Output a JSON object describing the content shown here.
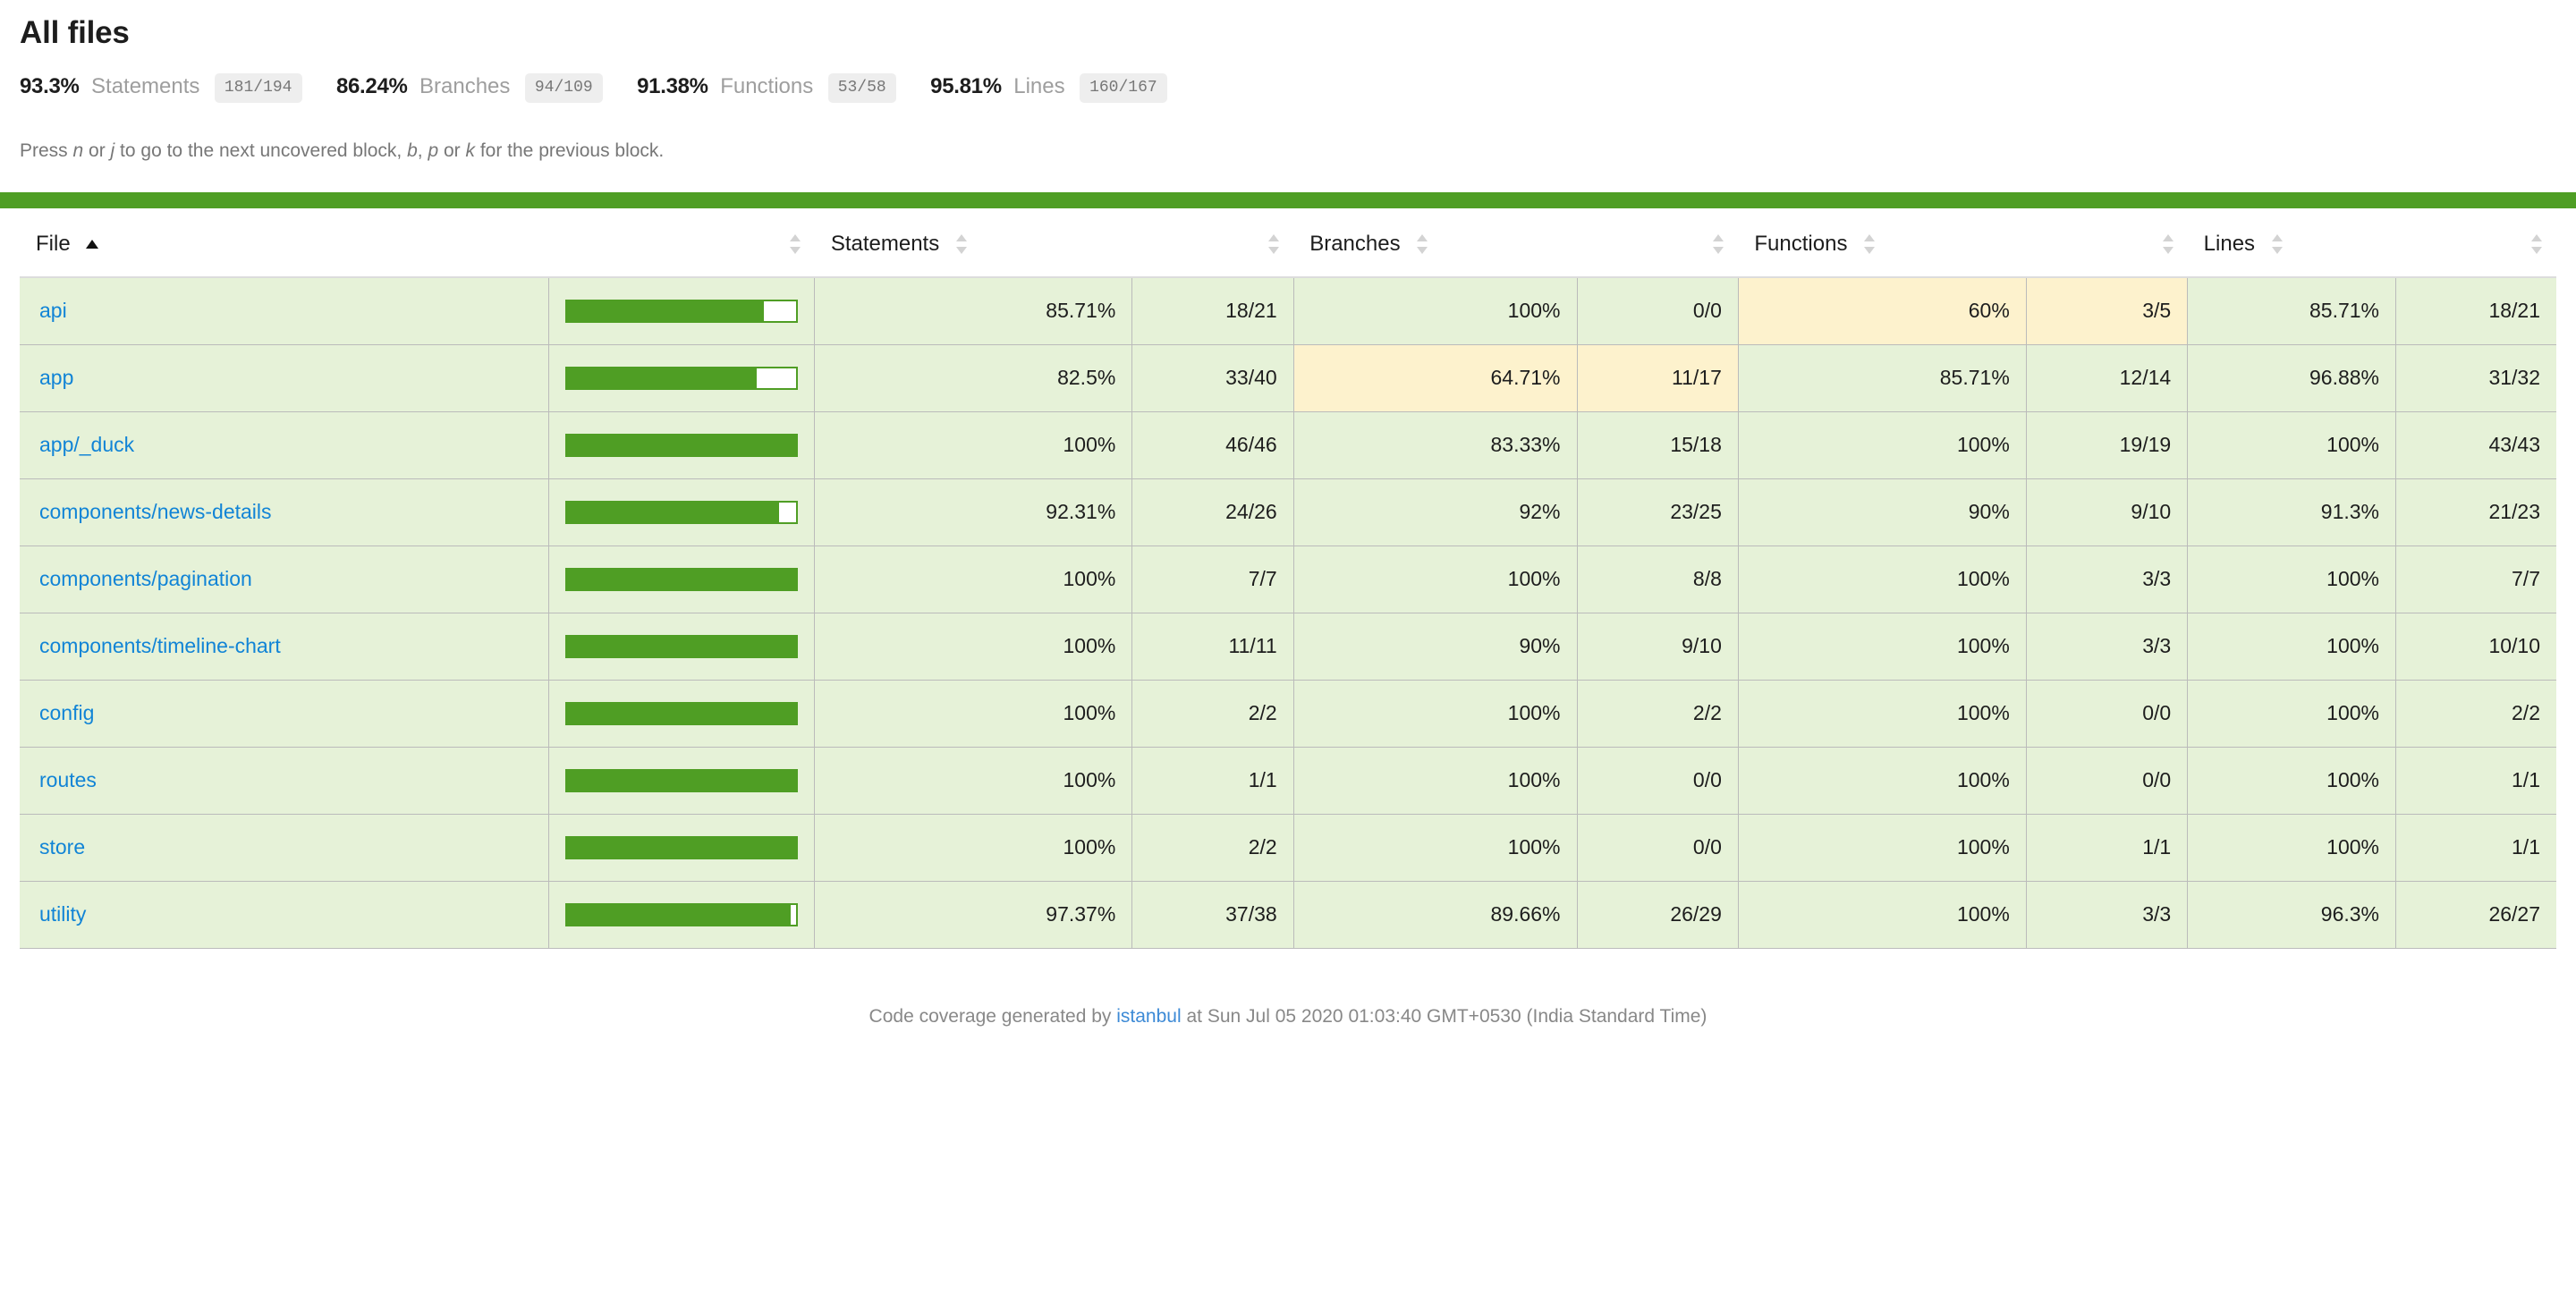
{
  "header": {
    "title": "All files",
    "summary": [
      {
        "pct": "93.3%",
        "label": "Statements",
        "fraction": "181/194"
      },
      {
        "pct": "86.24%",
        "label": "Branches",
        "fraction": "94/109"
      },
      {
        "pct": "91.38%",
        "label": "Functions",
        "fraction": "53/58"
      },
      {
        "pct": "95.81%",
        "label": "Lines",
        "fraction": "160/167"
      }
    ],
    "help_parts": {
      "p1": "Press ",
      "k1": "n",
      "p2": " or ",
      "k2": "j",
      "p3": " to go to the next uncovered block, ",
      "k3": "b",
      "p4": ", ",
      "k4": "p",
      "p5": " or ",
      "k5": "k",
      "p6": " for the previous block."
    },
    "status_color": "#4f9e24"
  },
  "table": {
    "columns": [
      {
        "key": "file",
        "label": "File",
        "sort": "asc"
      },
      {
        "key": "pic",
        "label": "",
        "sort": "none"
      },
      {
        "key": "statements",
        "label": "Statements",
        "sort": "none"
      },
      {
        "key": "statements_raw",
        "label": "",
        "sort": "none"
      },
      {
        "key": "branches",
        "label": "Branches",
        "sort": "none"
      },
      {
        "key": "branches_raw",
        "label": "",
        "sort": "none"
      },
      {
        "key": "functions",
        "label": "Functions",
        "sort": "none"
      },
      {
        "key": "functions_raw",
        "label": "",
        "sort": "none"
      },
      {
        "key": "lines",
        "label": "Lines",
        "sort": "none"
      },
      {
        "key": "lines_raw",
        "label": "",
        "sort": "none"
      }
    ],
    "rows": [
      {
        "file": "api",
        "bar_pct": 85.71,
        "bar_class": "high",
        "statements": {
          "pct": "85.71%",
          "raw": "18/21",
          "state": "high"
        },
        "branches": {
          "pct": "100%",
          "raw": "0/0",
          "state": "high"
        },
        "functions": {
          "pct": "60%",
          "raw": "3/5",
          "state": "medium"
        },
        "lines": {
          "pct": "85.71%",
          "raw": "18/21",
          "state": "high"
        }
      },
      {
        "file": "app",
        "bar_pct": 82.5,
        "bar_class": "high",
        "statements": {
          "pct": "82.5%",
          "raw": "33/40",
          "state": "high"
        },
        "branches": {
          "pct": "64.71%",
          "raw": "11/17",
          "state": "medium"
        },
        "functions": {
          "pct": "85.71%",
          "raw": "12/14",
          "state": "high"
        },
        "lines": {
          "pct": "96.88%",
          "raw": "31/32",
          "state": "high"
        }
      },
      {
        "file": "app/_duck",
        "bar_pct": 100,
        "bar_class": "high",
        "statements": {
          "pct": "100%",
          "raw": "46/46",
          "state": "high"
        },
        "branches": {
          "pct": "83.33%",
          "raw": "15/18",
          "state": "high"
        },
        "functions": {
          "pct": "100%",
          "raw": "19/19",
          "state": "high"
        },
        "lines": {
          "pct": "100%",
          "raw": "43/43",
          "state": "high"
        }
      },
      {
        "file": "components/news-details",
        "bar_pct": 92.31,
        "bar_class": "high",
        "statements": {
          "pct": "92.31%",
          "raw": "24/26",
          "state": "high"
        },
        "branches": {
          "pct": "92%",
          "raw": "23/25",
          "state": "high"
        },
        "functions": {
          "pct": "90%",
          "raw": "9/10",
          "state": "high"
        },
        "lines": {
          "pct": "91.3%",
          "raw": "21/23",
          "state": "high"
        }
      },
      {
        "file": "components/pagination",
        "bar_pct": 100,
        "bar_class": "high",
        "statements": {
          "pct": "100%",
          "raw": "7/7",
          "state": "high"
        },
        "branches": {
          "pct": "100%",
          "raw": "8/8",
          "state": "high"
        },
        "functions": {
          "pct": "100%",
          "raw": "3/3",
          "state": "high"
        },
        "lines": {
          "pct": "100%",
          "raw": "7/7",
          "state": "high"
        }
      },
      {
        "file": "components/timeline-chart",
        "bar_pct": 100,
        "bar_class": "high",
        "statements": {
          "pct": "100%",
          "raw": "11/11",
          "state": "high"
        },
        "branches": {
          "pct": "90%",
          "raw": "9/10",
          "state": "high"
        },
        "functions": {
          "pct": "100%",
          "raw": "3/3",
          "state": "high"
        },
        "lines": {
          "pct": "100%",
          "raw": "10/10",
          "state": "high"
        }
      },
      {
        "file": "config",
        "bar_pct": 100,
        "bar_class": "high",
        "statements": {
          "pct": "100%",
          "raw": "2/2",
          "state": "high"
        },
        "branches": {
          "pct": "100%",
          "raw": "2/2",
          "state": "high"
        },
        "functions": {
          "pct": "100%",
          "raw": "0/0",
          "state": "high"
        },
        "lines": {
          "pct": "100%",
          "raw": "2/2",
          "state": "high"
        }
      },
      {
        "file": "routes",
        "bar_pct": 100,
        "bar_class": "high",
        "statements": {
          "pct": "100%",
          "raw": "1/1",
          "state": "high"
        },
        "branches": {
          "pct": "100%",
          "raw": "0/0",
          "state": "high"
        },
        "functions": {
          "pct": "100%",
          "raw": "0/0",
          "state": "high"
        },
        "lines": {
          "pct": "100%",
          "raw": "1/1",
          "state": "high"
        }
      },
      {
        "file": "store",
        "bar_pct": 100,
        "bar_class": "high",
        "statements": {
          "pct": "100%",
          "raw": "2/2",
          "state": "high"
        },
        "branches": {
          "pct": "100%",
          "raw": "0/0",
          "state": "high"
        },
        "functions": {
          "pct": "100%",
          "raw": "1/1",
          "state": "high"
        },
        "lines": {
          "pct": "100%",
          "raw": "1/1",
          "state": "high"
        }
      },
      {
        "file": "utility",
        "bar_pct": 97.37,
        "bar_class": "high",
        "statements": {
          "pct": "97.37%",
          "raw": "37/38",
          "state": "high"
        },
        "branches": {
          "pct": "89.66%",
          "raw": "26/29",
          "state": "high"
        },
        "functions": {
          "pct": "100%",
          "raw": "3/3",
          "state": "high"
        },
        "lines": {
          "pct": "96.3%",
          "raw": "26/27",
          "state": "high"
        }
      }
    ]
  },
  "footer": {
    "prefix": "Code coverage generated by ",
    "link": "istanbul",
    "suffix": " at Sun Jul 05 2020 01:03:40 GMT+0530 (India Standard Time)"
  },
  "colors": {
    "bar_green": "#4f9e24",
    "high_bg": "#e6f2d8",
    "medium_bg": "#fdf2cd",
    "link_blue": "#1184d6"
  }
}
